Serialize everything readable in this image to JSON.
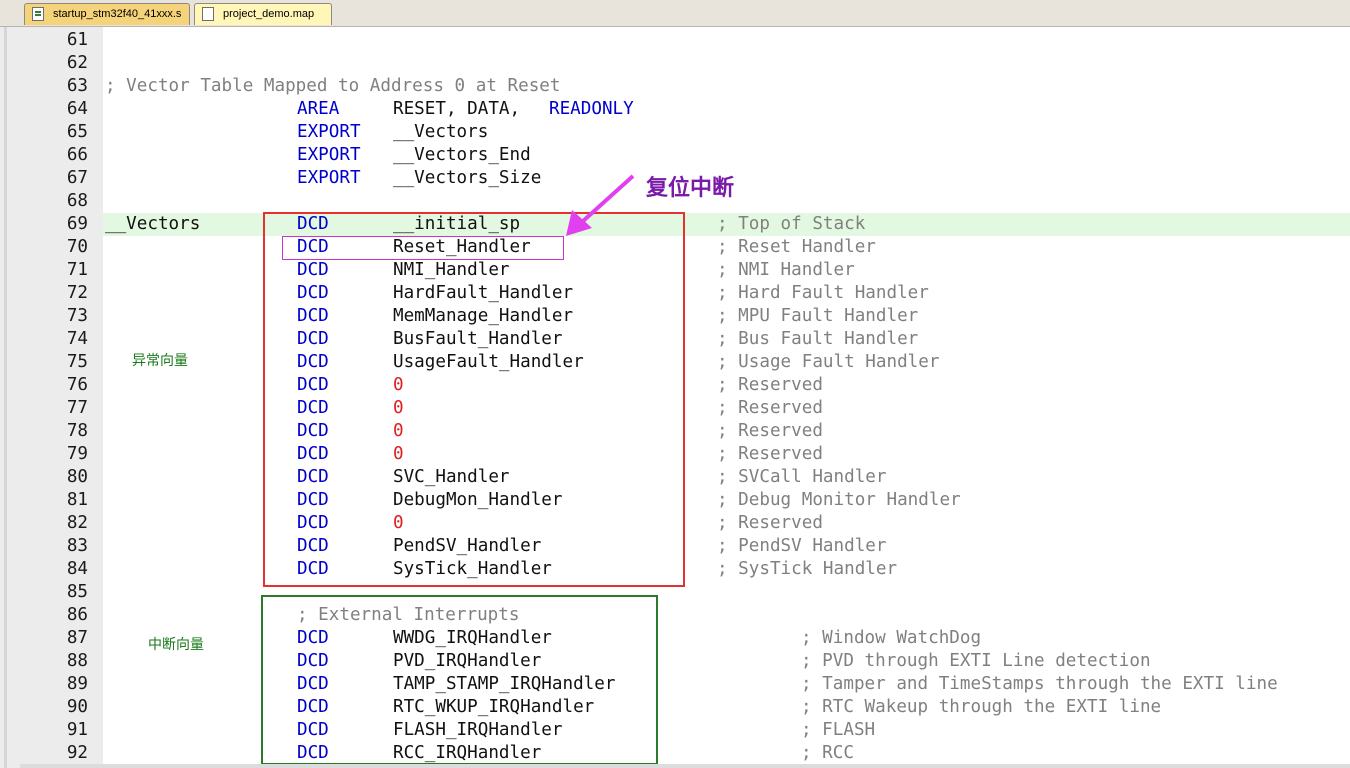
{
  "tabs": [
    {
      "label": "startup_stm32f40_41xxx.s",
      "active": true
    },
    {
      "label": "project_demo.map",
      "active": false
    }
  ],
  "colors": {
    "keyword": "#0000cc",
    "comment": "#808080",
    "number": "#e02020",
    "text": "#111111",
    "highlight": "#e3f8e0",
    "exception_box": "#e53030",
    "interrupt_box": "#2a7a2a",
    "reset_box": "#cc33cc",
    "arrow": "#e040f0",
    "annotation_purple": "#7a1aa8",
    "annotation_green": "#1a7a1a"
  },
  "lines": [
    {
      "n": "61",
      "parts": []
    },
    {
      "n": "62",
      "parts": []
    },
    {
      "n": "63",
      "parts": [
        {
          "col": 0,
          "cls": "cm",
          "t": "; Vector Table Mapped to Address 0 at Reset"
        }
      ]
    },
    {
      "n": "64",
      "parts": [
        {
          "col": 16,
          "cls": "kw",
          "t": "AREA"
        },
        {
          "col": 24,
          "cls": "tx",
          "t": "RESET, DATA, "
        },
        {
          "col": 37,
          "cls": "kw",
          "t": "READONLY"
        }
      ]
    },
    {
      "n": "65",
      "parts": [
        {
          "col": 16,
          "cls": "kw",
          "t": "EXPORT"
        },
        {
          "col": 24,
          "cls": "tx",
          "t": "__Vectors"
        }
      ]
    },
    {
      "n": "66",
      "parts": [
        {
          "col": 16,
          "cls": "kw",
          "t": "EXPORT"
        },
        {
          "col": 24,
          "cls": "tx",
          "t": "__Vectors_End"
        }
      ]
    },
    {
      "n": "67",
      "parts": [
        {
          "col": 16,
          "cls": "kw",
          "t": "EXPORT"
        },
        {
          "col": 24,
          "cls": "tx",
          "t": "__Vectors_Size"
        }
      ]
    },
    {
      "n": "68",
      "parts": []
    },
    {
      "n": "69",
      "hl": true,
      "parts": [
        {
          "col": 0,
          "cls": "tx",
          "t": "__Vectors"
        },
        {
          "col": 16,
          "cls": "kw",
          "t": "DCD"
        },
        {
          "col": 24,
          "cls": "tx",
          "t": "__initial_sp"
        },
        {
          "col": 51,
          "cls": "cm",
          "t": "; Top of Stack"
        }
      ]
    },
    {
      "n": "70",
      "parts": [
        {
          "col": 16,
          "cls": "kw",
          "t": "DCD"
        },
        {
          "col": 24,
          "cls": "tx",
          "t": "Reset_Handler"
        },
        {
          "col": 51,
          "cls": "cm",
          "t": "; Reset Handler"
        }
      ]
    },
    {
      "n": "71",
      "parts": [
        {
          "col": 16,
          "cls": "kw",
          "t": "DCD"
        },
        {
          "col": 24,
          "cls": "tx",
          "t": "NMI_Handler"
        },
        {
          "col": 51,
          "cls": "cm",
          "t": "; NMI Handler"
        }
      ]
    },
    {
      "n": "72",
      "parts": [
        {
          "col": 16,
          "cls": "kw",
          "t": "DCD"
        },
        {
          "col": 24,
          "cls": "tx",
          "t": "HardFault_Handler"
        },
        {
          "col": 51,
          "cls": "cm",
          "t": "; Hard Fault Handler"
        }
      ]
    },
    {
      "n": "73",
      "parts": [
        {
          "col": 16,
          "cls": "kw",
          "t": "DCD"
        },
        {
          "col": 24,
          "cls": "tx",
          "t": "MemManage_Handler"
        },
        {
          "col": 51,
          "cls": "cm",
          "t": "; MPU Fault Handler"
        }
      ]
    },
    {
      "n": "74",
      "parts": [
        {
          "col": 16,
          "cls": "kw",
          "t": "DCD"
        },
        {
          "col": 24,
          "cls": "tx",
          "t": "BusFault_Handler"
        },
        {
          "col": 51,
          "cls": "cm",
          "t": "; Bus Fault Handler"
        }
      ]
    },
    {
      "n": "75",
      "parts": [
        {
          "col": 16,
          "cls": "kw",
          "t": "DCD"
        },
        {
          "col": 24,
          "cls": "tx",
          "t": "UsageFault_Handler"
        },
        {
          "col": 51,
          "cls": "cm",
          "t": "; Usage Fault Handler"
        }
      ]
    },
    {
      "n": "76",
      "parts": [
        {
          "col": 16,
          "cls": "kw",
          "t": "DCD"
        },
        {
          "col": 24,
          "cls": "num",
          "t": "0"
        },
        {
          "col": 51,
          "cls": "cm",
          "t": "; Reserved"
        }
      ]
    },
    {
      "n": "77",
      "parts": [
        {
          "col": 16,
          "cls": "kw",
          "t": "DCD"
        },
        {
          "col": 24,
          "cls": "num",
          "t": "0"
        },
        {
          "col": 51,
          "cls": "cm",
          "t": "; Reserved"
        }
      ]
    },
    {
      "n": "78",
      "parts": [
        {
          "col": 16,
          "cls": "kw",
          "t": "DCD"
        },
        {
          "col": 24,
          "cls": "num",
          "t": "0"
        },
        {
          "col": 51,
          "cls": "cm",
          "t": "; Reserved"
        }
      ]
    },
    {
      "n": "79",
      "parts": [
        {
          "col": 16,
          "cls": "kw",
          "t": "DCD"
        },
        {
          "col": 24,
          "cls": "num",
          "t": "0"
        },
        {
          "col": 51,
          "cls": "cm",
          "t": "; Reserved"
        }
      ]
    },
    {
      "n": "80",
      "parts": [
        {
          "col": 16,
          "cls": "kw",
          "t": "DCD"
        },
        {
          "col": 24,
          "cls": "tx",
          "t": "SVC_Handler"
        },
        {
          "col": 51,
          "cls": "cm",
          "t": "; SVCall Handler"
        }
      ]
    },
    {
      "n": "81",
      "parts": [
        {
          "col": 16,
          "cls": "kw",
          "t": "DCD"
        },
        {
          "col": 24,
          "cls": "tx",
          "t": "DebugMon_Handler"
        },
        {
          "col": 51,
          "cls": "cm",
          "t": "; Debug Monitor Handler"
        }
      ]
    },
    {
      "n": "82",
      "parts": [
        {
          "col": 16,
          "cls": "kw",
          "t": "DCD"
        },
        {
          "col": 24,
          "cls": "num",
          "t": "0"
        },
        {
          "col": 51,
          "cls": "cm",
          "t": "; Reserved"
        }
      ]
    },
    {
      "n": "83",
      "parts": [
        {
          "col": 16,
          "cls": "kw",
          "t": "DCD"
        },
        {
          "col": 24,
          "cls": "tx",
          "t": "PendSV_Handler"
        },
        {
          "col": 51,
          "cls": "cm",
          "t": "; PendSV Handler"
        }
      ]
    },
    {
      "n": "84",
      "parts": [
        {
          "col": 16,
          "cls": "kw",
          "t": "DCD"
        },
        {
          "col": 24,
          "cls": "tx",
          "t": "SysTick_Handler"
        },
        {
          "col": 51,
          "cls": "cm",
          "t": "; SysTick Handler"
        }
      ]
    },
    {
      "n": "85",
      "parts": []
    },
    {
      "n": "86",
      "parts": [
        {
          "col": 16,
          "cls": "cm",
          "t": "; External Interrupts"
        }
      ]
    },
    {
      "n": "87",
      "parts": [
        {
          "col": 16,
          "cls": "kw",
          "t": "DCD"
        },
        {
          "col": 24,
          "cls": "tx",
          "t": "WWDG_IRQHandler"
        },
        {
          "col": 58,
          "cls": "cm",
          "t": "; Window WatchDog"
        }
      ]
    },
    {
      "n": "88",
      "parts": [
        {
          "col": 16,
          "cls": "kw",
          "t": "DCD"
        },
        {
          "col": 24,
          "cls": "tx",
          "t": "PVD_IRQHandler"
        },
        {
          "col": 58,
          "cls": "cm",
          "t": "; PVD through EXTI Line detection"
        }
      ]
    },
    {
      "n": "89",
      "parts": [
        {
          "col": 16,
          "cls": "kw",
          "t": "DCD"
        },
        {
          "col": 24,
          "cls": "tx",
          "t": "TAMP_STAMP_IRQHandler"
        },
        {
          "col": 58,
          "cls": "cm",
          "t": "; Tamper and TimeStamps through the EXTI line"
        }
      ]
    },
    {
      "n": "90",
      "parts": [
        {
          "col": 16,
          "cls": "kw",
          "t": "DCD"
        },
        {
          "col": 24,
          "cls": "tx",
          "t": "RTC_WKUP_IRQHandler"
        },
        {
          "col": 58,
          "cls": "cm",
          "t": "; RTC Wakeup through the EXTI line"
        }
      ]
    },
    {
      "n": "91",
      "parts": [
        {
          "col": 16,
          "cls": "kw",
          "t": "DCD"
        },
        {
          "col": 24,
          "cls": "tx",
          "t": "FLASH_IRQHandler"
        },
        {
          "col": 58,
          "cls": "cm",
          "t": "; FLASH"
        }
      ]
    },
    {
      "n": "92",
      "parts": [
        {
          "col": 16,
          "cls": "kw",
          "t": "DCD"
        },
        {
          "col": 24,
          "cls": "tx",
          "t": "RCC_IRQHandler"
        },
        {
          "col": 58,
          "cls": "cm",
          "t": "; RCC"
        }
      ]
    }
  ],
  "annotations": {
    "reset_interrupt": "复位中断",
    "exception_vectors": "异常向量",
    "interrupt_vectors": "中断向量"
  }
}
